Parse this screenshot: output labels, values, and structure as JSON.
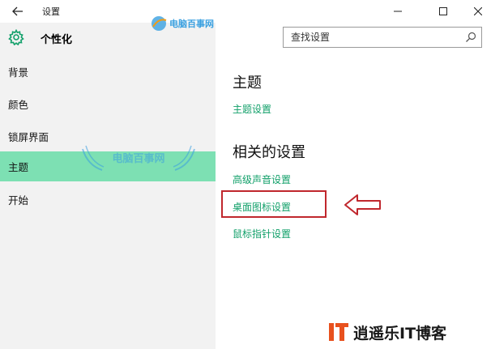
{
  "window": {
    "title": "设置"
  },
  "header": {
    "page_title": "个性化",
    "search_placeholder": "查找设置"
  },
  "nav": {
    "items": [
      {
        "label": "背景",
        "selected": false
      },
      {
        "label": "颜色",
        "selected": false
      },
      {
        "label": "锁屏界面",
        "selected": false
      },
      {
        "label": "主题",
        "selected": true
      },
      {
        "label": "开始",
        "selected": false
      }
    ]
  },
  "content": {
    "theme_heading": "主题",
    "theme_settings_link": "主题设置",
    "related_heading": "相关的设置",
    "links": [
      "高级声音设置",
      "桌面图标设置",
      "鼠标指针设置"
    ]
  },
  "watermarks": {
    "top": "电脑百事网",
    "middle": "电脑百事网",
    "logo": "逍遥乐IT博客"
  },
  "colors": {
    "accent": "#12a06a",
    "selected_bg": "#7de0b3",
    "pane_bg": "#f2f2f2",
    "annotation_red": "#c0272d"
  },
  "icons": {
    "back": "back-arrow-icon",
    "minimize": "minimize-icon",
    "maximize": "maximize-icon",
    "close": "close-icon",
    "gear": "gear-icon",
    "search": "search-icon",
    "annotation_arrow": "left-arrow-icon"
  }
}
